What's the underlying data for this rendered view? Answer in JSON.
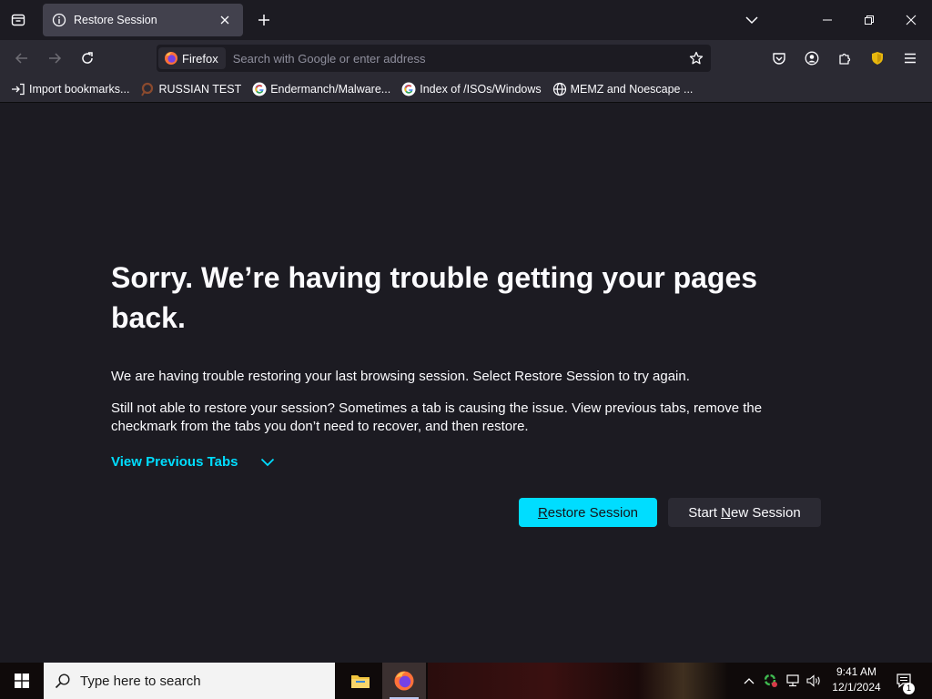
{
  "browser": {
    "tab": {
      "title": "Restore Session"
    },
    "identity_label": "Firefox",
    "urlbar": {
      "placeholder": "Search with Google or enter address",
      "value": ""
    },
    "bookmarks": [
      {
        "label": "Import bookmarks...",
        "icon": "import-icon"
      },
      {
        "label": "RUSSIAN TEST",
        "icon": "magnifier-icon"
      },
      {
        "label": "Endermanch/Malware...",
        "icon": "google-icon"
      },
      {
        "label": "Index of /ISOs/Windows",
        "icon": "google-icon"
      },
      {
        "label": "MEMZ and Noescape ...",
        "icon": "globe-icon"
      }
    ]
  },
  "page": {
    "title": "Sorry. We’re having trouble getting your pages back.",
    "paragraph1": "We are having trouble restoring your last browsing session. Select Restore Session to try again.",
    "paragraph2": "Still not able to restore your session? Sometimes a tab is causing the issue. View previous tabs, remove the checkmark from the tabs you don’t need to recover, and then restore.",
    "view_previous_tabs": "View Previous Tabs",
    "restore_button": {
      "access_key": "R",
      "rest": "estore Session"
    },
    "new_session_button": {
      "pre": "Start ",
      "access_key": "N",
      "rest": "ew Session"
    }
  },
  "taskbar": {
    "search_placeholder": "Type here to search",
    "time": "9:41 AM",
    "date": "12/1/2024",
    "notification_count": "1"
  },
  "colors": {
    "accent": "#00ddff",
    "page_bg": "#1c1b22",
    "toolbar_bg": "#2b2a33"
  }
}
